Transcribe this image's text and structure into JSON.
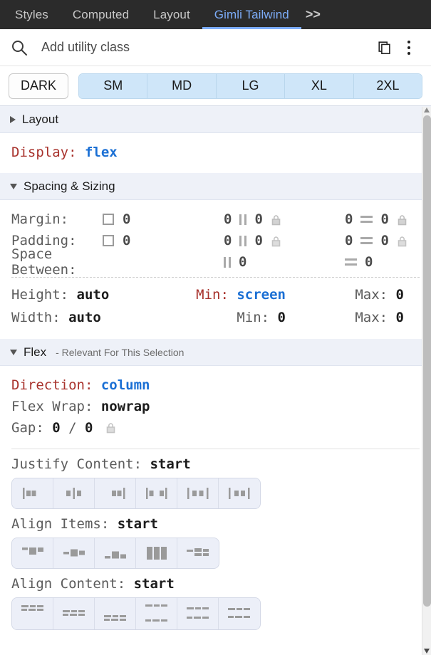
{
  "tabs": [
    {
      "label": "Styles",
      "active": false
    },
    {
      "label": "Computed",
      "active": false
    },
    {
      "label": "Layout",
      "active": false
    },
    {
      "label": "Gimli Tailwind",
      "active": true
    }
  ],
  "tabs_overflow_label": ">>",
  "search": {
    "icon": "search-icon",
    "placeholder": "Add utility class",
    "value": "",
    "copy_icon": "copy-icon",
    "menu_icon": "kebab-menu-icon"
  },
  "breakpoints": {
    "dark_label": "DARK",
    "items": [
      "SM",
      "MD",
      "LG",
      "XL",
      "2XL"
    ]
  },
  "sections": {
    "layout": {
      "title": "Layout",
      "expanded": false,
      "display": {
        "label": "Display:",
        "value": "flex"
      }
    },
    "spacing": {
      "title": "Spacing & Sizing",
      "expanded": true,
      "rows": [
        {
          "label": "Margin:",
          "all_icon": "square-icon",
          "all_value": "0",
          "x_left": "0",
          "x_icon": "vertical-bars-icon",
          "x_right": "0",
          "x_lock": "lock-icon",
          "y_left": "0",
          "y_icon": "horizontal-bars-icon",
          "y_right": "0",
          "y_lock": "lock-icon"
        },
        {
          "label": "Padding:",
          "all_icon": "square-icon",
          "all_value": "0",
          "x_left": "0",
          "x_icon": "vertical-bars-icon",
          "x_right": "0",
          "x_lock": "lock-icon",
          "y_left": "0",
          "y_icon": "horizontal-bars-icon",
          "y_right": "0",
          "y_lock": "lock-icon"
        },
        {
          "label": "Space Between:",
          "all_icon": "",
          "all_value": "",
          "x_left": "",
          "x_icon": "vertical-bars-icon",
          "x_right": "0",
          "x_lock": "",
          "y_left": "",
          "y_icon": "horizontal-bars-icon",
          "y_right": "0",
          "y_lock": ""
        }
      ],
      "height": {
        "label": "Height:",
        "value": "auto",
        "min_label": "Min:",
        "min_value": "screen",
        "min_highlighted": true,
        "max_label": "Max:",
        "max_value": "0"
      },
      "width": {
        "label": "Width:",
        "value": "auto",
        "min_label": "Min:",
        "min_value": "0",
        "min_highlighted": false,
        "max_label": "Max:",
        "max_value": "0"
      }
    },
    "flex": {
      "title": "Flex",
      "note": "- Relevant For This Selection",
      "expanded": true,
      "direction": {
        "label": "Direction:",
        "value": "column"
      },
      "wrap": {
        "label": "Flex Wrap:",
        "value": "nowrap"
      },
      "gap": {
        "label": "Gap:",
        "value_x": "0",
        "sep": "/",
        "value_y": "0",
        "lock": "lock-icon"
      },
      "justify_content": {
        "label": "Justify Content:",
        "value": "start",
        "options": [
          "justify-start",
          "justify-center",
          "justify-end",
          "justify-between",
          "justify-around",
          "justify-evenly"
        ]
      },
      "align_items": {
        "label": "Align Items:",
        "value": "start",
        "options": [
          "items-start",
          "items-center",
          "items-end",
          "items-stretch",
          "items-baseline"
        ]
      },
      "align_content": {
        "label": "Align Content:",
        "value": "start",
        "options": [
          "content-start",
          "content-center",
          "content-end",
          "content-between",
          "content-around",
          "content-evenly"
        ]
      }
    }
  },
  "colors": {
    "tabbar_bg": "#2b2b2b",
    "active_tab": "#7cacf8",
    "breakpoint_bg": "#cfe6f9",
    "section_header_bg": "#eef1f8",
    "property_red": "#a8322c",
    "value_blue": "#1a6fd4"
  }
}
